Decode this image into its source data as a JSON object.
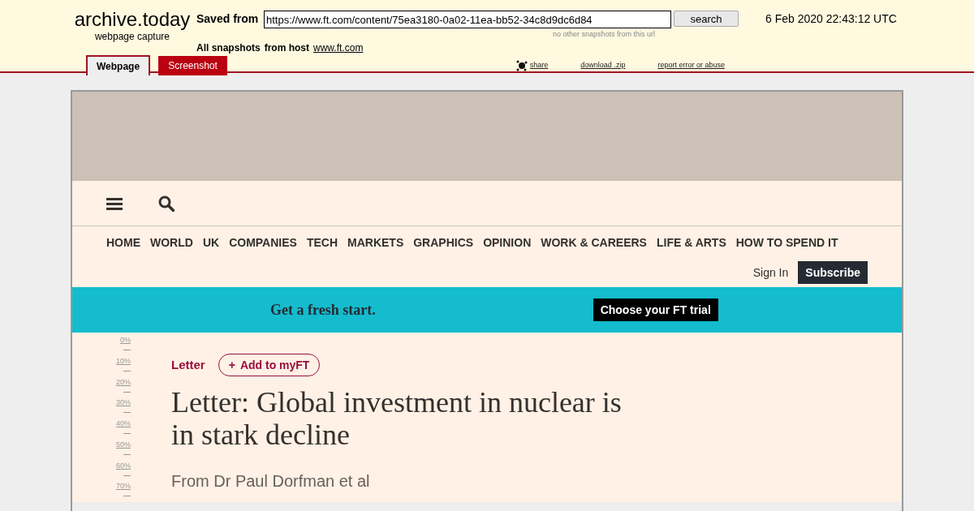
{
  "header": {
    "logo": "archive.today",
    "tagline": "webpage capture",
    "saved_from_label": "Saved from",
    "url": "https://www.ft.com/content/75ea3180-0a02-11ea-bb52-34c8d9dc6d84",
    "search_button": "search",
    "note": "no other snapshots from this url",
    "date": "6 Feb 2020 22:43:12 UTC",
    "all_snapshots": "All snapshots",
    "from_host_label": "from host",
    "host": "www.ft.com"
  },
  "tabs": [
    {
      "label": "Webpage",
      "selected": true
    },
    {
      "label": "Screenshot",
      "selected": false
    }
  ],
  "actions": [
    {
      "kind": "share",
      "label": "share"
    },
    {
      "kind": "link",
      "label": "download .zip"
    },
    {
      "kind": "link",
      "label": "report error or abuse"
    }
  ],
  "scroll_markers": [
    "0%",
    "10%",
    "20%",
    "30%",
    "40%",
    "50%",
    "60%",
    "70%"
  ],
  "ft": {
    "nav": [
      "HOME",
      "WORLD",
      "UK",
      "COMPANIES",
      "TECH",
      "MARKETS",
      "GRAPHICS",
      "OPINION",
      "WORK & CAREERS",
      "LIFE & ARTS",
      "HOW TO SPEND IT"
    ],
    "sign_in": "Sign In",
    "subscribe": "Subscribe",
    "banner": {
      "text": "Get a fresh start.",
      "button": "Choose your FT trial"
    },
    "article": {
      "tag": "Letter",
      "follow_icon": "+",
      "follow": "Add to myFT",
      "headline": "Letter: Global investment in nuclear is in stark decline",
      "byline": "From Dr Paul Dorfman et al"
    }
  }
}
